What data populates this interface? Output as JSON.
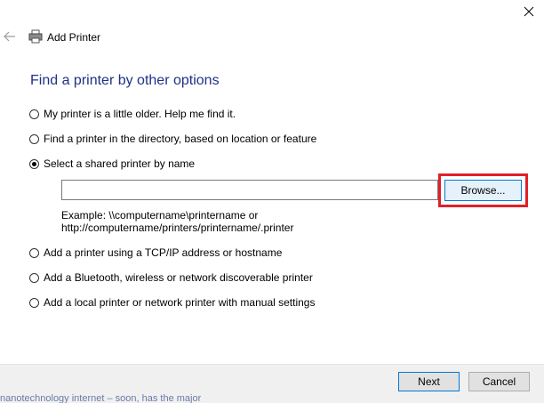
{
  "window": {
    "title": "Add Printer",
    "heading": "Find a printer by other options"
  },
  "options": [
    {
      "label": "My printer is a little older. Help me find it.",
      "checked": false
    },
    {
      "label": "Find a printer in the directory, based on location or feature",
      "checked": false
    },
    {
      "label": "Select a shared printer by name",
      "checked": true
    },
    {
      "label": "Add a printer using a TCP/IP address or hostname",
      "checked": false
    },
    {
      "label": "Add a Bluetooth, wireless or network discoverable printer",
      "checked": false
    },
    {
      "label": "Add a local printer or network printer with manual settings",
      "checked": false
    }
  ],
  "shared_printer": {
    "value": "",
    "browse_label": "Browse...",
    "example_line1": "Example: \\\\computername\\printername or",
    "example_line2": "http://computername/printers/printername/.printer"
  },
  "footer": {
    "next_label": "Next",
    "cancel_label": "Cancel"
  },
  "background_text": "nanotechnology internet – soon, has the major",
  "colors": {
    "heading": "#1e3287",
    "highlight": "#e0202a",
    "button_focus": "#0078d7"
  },
  "icons": [
    "close-icon",
    "back-arrow-icon",
    "printer-icon"
  ]
}
